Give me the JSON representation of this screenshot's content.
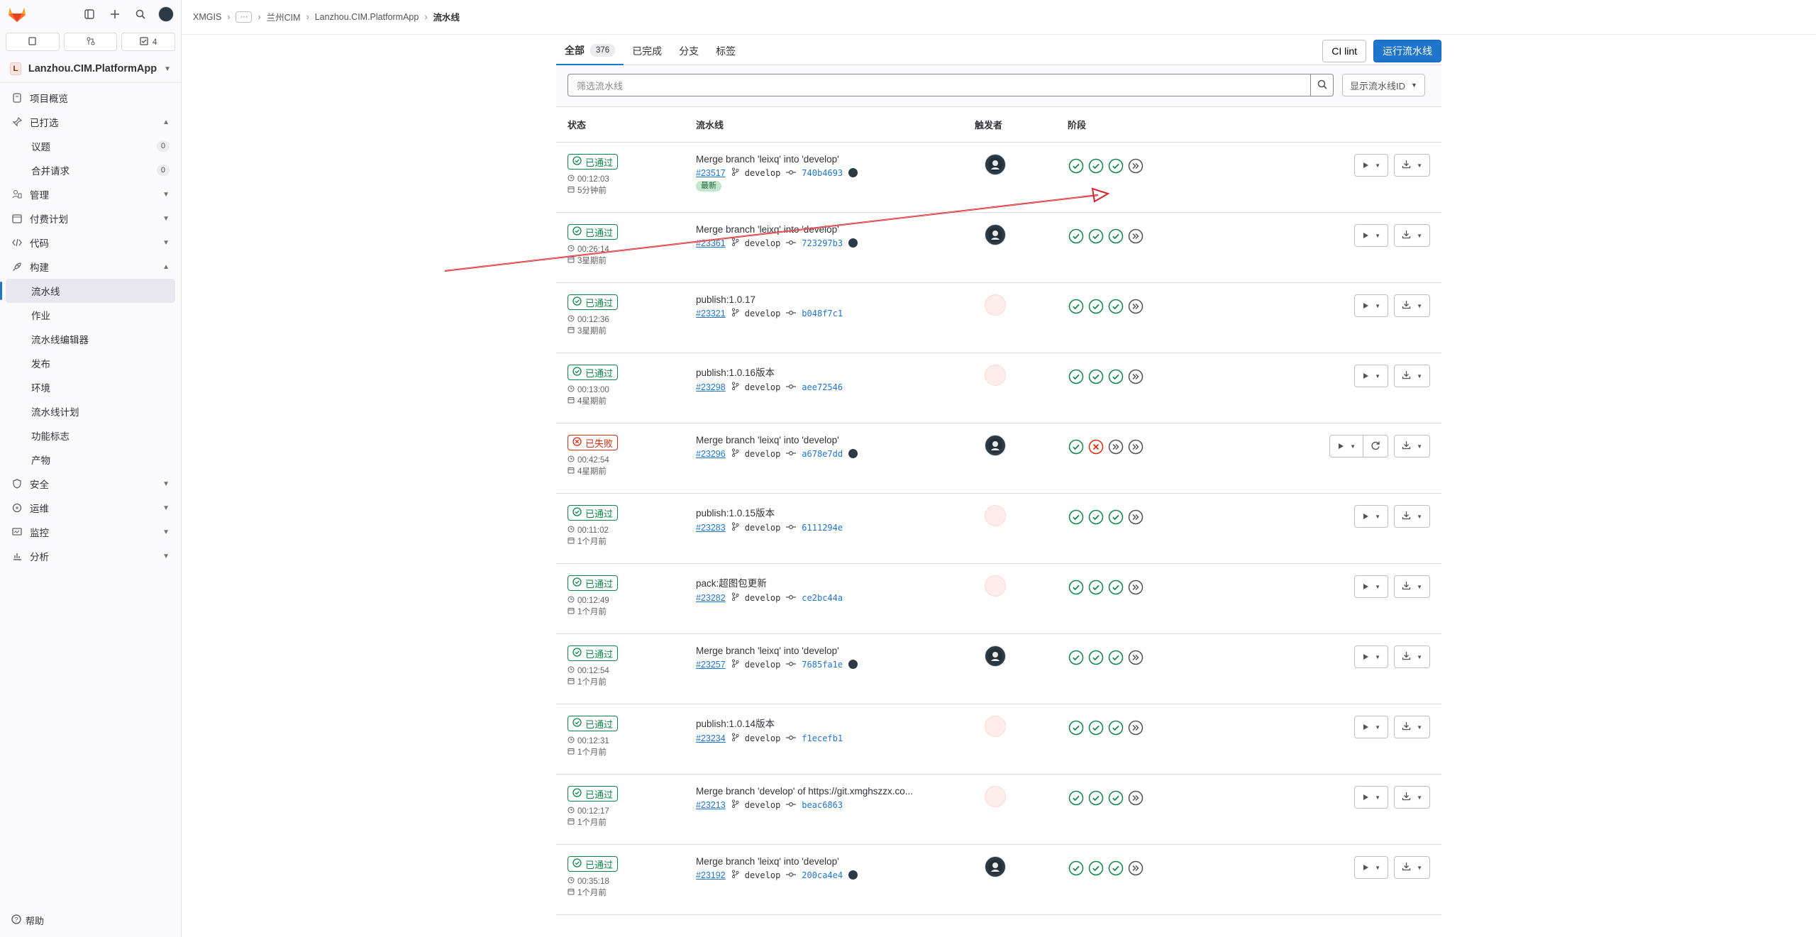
{
  "sidebar": {
    "counters": [
      {
        "icon": "issues-icon",
        "count": ""
      },
      {
        "icon": "merge-request-icon",
        "count": ""
      },
      {
        "icon": "todo-icon",
        "count": "4"
      }
    ],
    "project_badge": "L",
    "project_name": "Lanzhou.CIM.PlatformApp",
    "items": [
      {
        "label": "项目概览",
        "icon": "project-icon",
        "sub": false
      },
      {
        "label": "已打选",
        "icon": "pin-icon",
        "sub": false,
        "chevron": "up"
      },
      {
        "label": "议题",
        "sub": true,
        "count": "0"
      },
      {
        "label": "合并请求",
        "sub": true,
        "count": "0"
      },
      {
        "label": "管理",
        "icon": "users-icon",
        "sub": false,
        "chevron": "down"
      },
      {
        "label": "付费计划",
        "icon": "calendar-icon",
        "sub": false,
        "chevron": "down"
      },
      {
        "label": "代码",
        "icon": "code-icon",
        "sub": false,
        "chevron": "down"
      },
      {
        "label": "构建",
        "icon": "rocket-icon",
        "sub": false,
        "chevron": "up"
      },
      {
        "label": "流水线",
        "sub": true,
        "active": true
      },
      {
        "label": "作业",
        "sub": true
      },
      {
        "label": "流水线编辑器",
        "sub": true
      },
      {
        "label": "发布",
        "sub": true
      },
      {
        "label": "环境",
        "sub": true
      },
      {
        "label": "流水线计划",
        "sub": true
      },
      {
        "label": "功能标志",
        "sub": true
      },
      {
        "label": "产物",
        "sub": true
      },
      {
        "label": "安全",
        "icon": "shield-icon",
        "sub": false,
        "chevron": "down"
      },
      {
        "label": "运维",
        "icon": "deployments-icon",
        "sub": false,
        "chevron": "down"
      },
      {
        "label": "监控",
        "icon": "monitor-icon",
        "sub": false,
        "chevron": "down"
      },
      {
        "label": "分析",
        "icon": "chart-icon",
        "sub": false,
        "chevron": "down"
      }
    ],
    "help": "帮助"
  },
  "breadcrumb": [
    "XMGIS",
    "兰州CIM",
    "Lanzhou.CIM.PlatformApp",
    "流水线"
  ],
  "tabs": [
    {
      "label": "全部",
      "count": "376",
      "active": true
    },
    {
      "label": "已完成"
    },
    {
      "label": "分支"
    },
    {
      "label": "标签"
    }
  ],
  "buttons": {
    "ci_lint": "CI lint",
    "run_pipeline": "运行流水线"
  },
  "filter": {
    "placeholder": "筛选流水线",
    "show_id": "显示流水线ID"
  },
  "table_headers": {
    "status": "状态",
    "pipeline": "流水线",
    "trigger": "触发者",
    "stages": "阶段"
  },
  "rows": [
    {
      "status": "已通过",
      "failed": false,
      "duration": "00:12:03",
      "ago": "5分钟前",
      "title": "Merge branch 'leixq' into 'develop'",
      "id": "#23517",
      "branch": "develop",
      "sha": "740b4693",
      "commit_avatar": true,
      "latest": "最新",
      "trigger_avatar": true,
      "stages": [
        "success",
        "success",
        "success",
        "skipped"
      ],
      "retry": false
    },
    {
      "status": "已通过",
      "failed": false,
      "duration": "00:26:14",
      "ago": "3星期前",
      "title": "Merge branch 'leixq' into 'develop'",
      "id": "#23361",
      "branch": "develop",
      "sha": "723297b3",
      "commit_avatar": true,
      "trigger_avatar": true,
      "stages": [
        "success",
        "success",
        "success",
        "skipped"
      ],
      "retry": false
    },
    {
      "status": "已通过",
      "failed": false,
      "duration": "00:12:36",
      "ago": "3星期前",
      "title": "publish:1.0.17",
      "id": "#23321",
      "branch": "develop",
      "sha": "b048f7c1",
      "commit_avatar": false,
      "trigger_avatar": false,
      "stages": [
        "success",
        "success",
        "success",
        "skipped"
      ],
      "retry": false
    },
    {
      "status": "已通过",
      "failed": false,
      "duration": "00:13:00",
      "ago": "4星期前",
      "title": "publish:1.0.16版本",
      "id": "#23298",
      "branch": "develop",
      "sha": "aee72546",
      "commit_avatar": false,
      "trigger_avatar": false,
      "stages": [
        "success",
        "success",
        "success",
        "skipped"
      ],
      "retry": false
    },
    {
      "status": "已失败",
      "failed": true,
      "duration": "00:42:54",
      "ago": "4星期前",
      "title": "Merge branch 'leixq' into 'develop'",
      "id": "#23296",
      "branch": "develop",
      "sha": "a678e7dd",
      "commit_avatar": true,
      "trigger_avatar": true,
      "stages": [
        "success",
        "failed",
        "skipped",
        "skipped"
      ],
      "retry": true
    },
    {
      "status": "已通过",
      "failed": false,
      "duration": "00:11:02",
      "ago": "1个月前",
      "title": "publish:1.0.15版本",
      "id": "#23283",
      "branch": "develop",
      "sha": "6111294e",
      "commit_avatar": false,
      "trigger_avatar": false,
      "stages": [
        "success",
        "success",
        "success",
        "skipped"
      ],
      "retry": false
    },
    {
      "status": "已通过",
      "failed": false,
      "duration": "00:12:49",
      "ago": "1个月前",
      "title": "pack:超图包更新",
      "id": "#23282",
      "branch": "develop",
      "sha": "ce2bc44a",
      "commit_avatar": false,
      "trigger_avatar": false,
      "stages": [
        "success",
        "success",
        "success",
        "skipped"
      ],
      "retry": false
    },
    {
      "status": "已通过",
      "failed": false,
      "duration": "00:12:54",
      "ago": "1个月前",
      "title": "Merge branch 'leixq' into 'develop'",
      "id": "#23257",
      "branch": "develop",
      "sha": "7685fa1e",
      "commit_avatar": true,
      "trigger_avatar": true,
      "stages": [
        "success",
        "success",
        "success",
        "skipped"
      ],
      "retry": false
    },
    {
      "status": "已通过",
      "failed": false,
      "duration": "00:12:31",
      "ago": "1个月前",
      "title": "publish:1.0.14版本",
      "id": "#23234",
      "branch": "develop",
      "sha": "f1ecefb1",
      "commit_avatar": false,
      "trigger_avatar": false,
      "stages": [
        "success",
        "success",
        "success",
        "skipped"
      ],
      "retry": false
    },
    {
      "status": "已通过",
      "failed": false,
      "duration": "00:12:17",
      "ago": "1个月前",
      "title": "Merge branch 'develop' of https://git.xmghszzx.co...",
      "id": "#23213",
      "branch": "develop",
      "sha": "beac6863",
      "commit_avatar": false,
      "trigger_avatar": false,
      "stages": [
        "success",
        "success",
        "success",
        "skipped"
      ],
      "retry": false
    },
    {
      "status": "已通过",
      "failed": false,
      "duration": "00:35:18",
      "ago": "1个月前",
      "title": "Merge branch 'leixq' into 'develop'",
      "id": "#23192",
      "branch": "develop",
      "sha": "200ca4e4",
      "commit_avatar": true,
      "trigger_avatar": true,
      "stages": [
        "success",
        "success",
        "success",
        "skipped"
      ],
      "retry": false
    }
  ],
  "colors": {
    "success": "#108548",
    "failed": "#dd2b0e",
    "link": "#1f75cb",
    "annotation_arrow": "#d9262c"
  }
}
